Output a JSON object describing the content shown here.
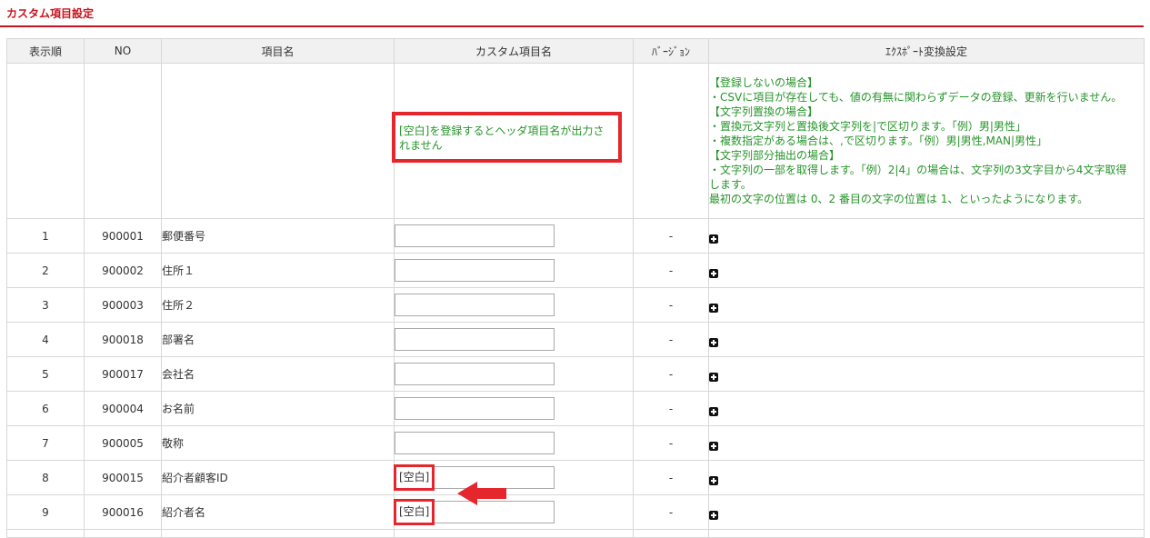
{
  "page": {
    "title": "カスタム項目設定"
  },
  "table": {
    "headers": {
      "order": "表示順",
      "no": "NO",
      "item_name": "項目名",
      "custom_name": "カスタム項目名",
      "version": "ﾊﾞｰｼﾞｮﾝ",
      "export": "ｴｸｽﾎﾟｰﾄ変換設定"
    },
    "note_row": {
      "custom_note": "[空白]を登録するとヘッダ項目名が出力されません",
      "export_note_lines": [
        "【登録しないの場合】",
        "・CSVに項目が存在しても、値の有無に関わらずデータの登録、更新を行いません。",
        "【文字列置換の場合】",
        "・置換元文字列と置換後文字列を|で区切ります。「例）男|男性」",
        "・複数指定がある場合は、,で区切ります。「例）男|男性,MAN|男性」",
        "【文字列部分抽出の場合】",
        "・文字列の一部を取得します。「例）2|4」の場合は、文字列の3文字目から4文字取得します。",
        "最初の文字の位置は 0、2 番目の文字の位置は 1、といったようになります。"
      ]
    },
    "rows": [
      {
        "order": "1",
        "no": "900001",
        "name": "郵便番号",
        "custom": "",
        "version": "-"
      },
      {
        "order": "2",
        "no": "900002",
        "name": "住所１",
        "custom": "",
        "version": "-"
      },
      {
        "order": "3",
        "no": "900003",
        "name": "住所２",
        "custom": "",
        "version": "-"
      },
      {
        "order": "4",
        "no": "900018",
        "name": "部署名",
        "custom": "",
        "version": "-"
      },
      {
        "order": "5",
        "no": "900017",
        "name": "会社名",
        "custom": "",
        "version": "-"
      },
      {
        "order": "6",
        "no": "900004",
        "name": "お名前",
        "custom": "",
        "version": "-"
      },
      {
        "order": "7",
        "no": "900005",
        "name": "敬称",
        "custom": "",
        "version": "-"
      },
      {
        "order": "8",
        "no": "900015",
        "name": "紹介者顧客ID",
        "custom": "[空白]",
        "version": "-"
      },
      {
        "order": "9",
        "no": "900016",
        "name": "紹介者名",
        "custom": "[空白]",
        "version": "-"
      }
    ]
  },
  "icons": {
    "expand": "plus-square-icon",
    "annotation_arrow": "arrow-left-icon"
  },
  "colors": {
    "accent": "#c8141e",
    "note_text": "#26942a",
    "highlight": "#e6262d"
  }
}
